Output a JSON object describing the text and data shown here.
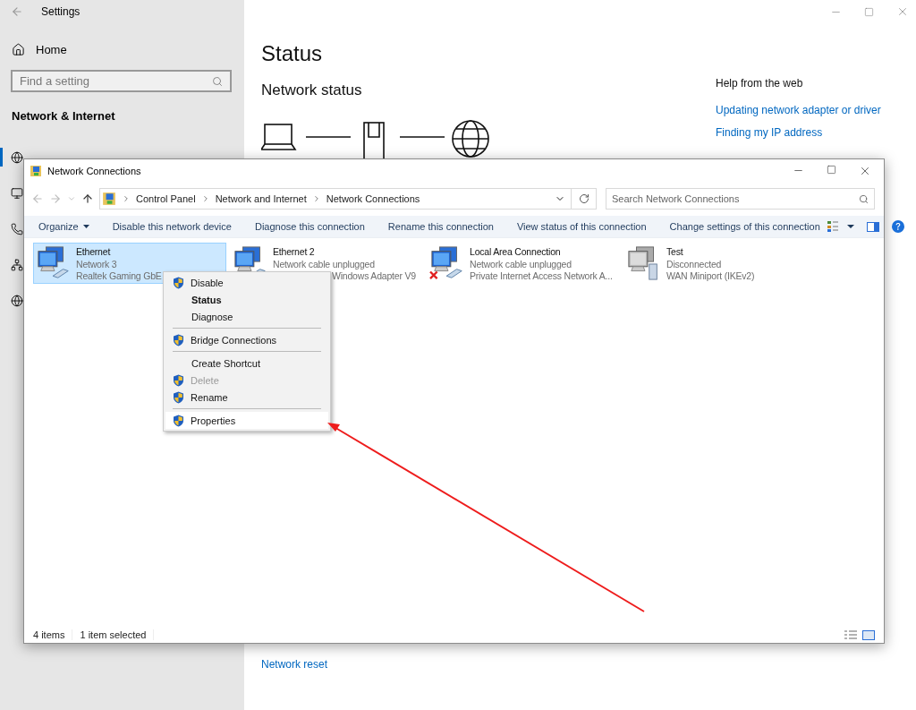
{
  "settings": {
    "title": "Settings",
    "home": "Home",
    "search": {
      "placeholder": "Find a setting"
    },
    "section": "Network & Internet",
    "nav_items": [
      {
        "kind": "status",
        "selected": true
      },
      {
        "kind": "ethernet",
        "selected": false
      },
      {
        "kind": "dialup",
        "selected": false
      },
      {
        "kind": "vpn",
        "selected": false
      },
      {
        "kind": "proxy",
        "selected": false
      }
    ],
    "heading": "Status",
    "subheading": "Network status",
    "help": {
      "title": "Help from the web",
      "links": [
        "Updating network adapter or driver",
        "Finding my IP address"
      ]
    },
    "reset_link": "Network reset"
  },
  "connections_window": {
    "title": "Network Connections",
    "breadcrumb": [
      "Control Panel",
      "Network and Internet",
      "Network Connections"
    ],
    "search": {
      "placeholder": "Search Network Connections"
    },
    "commands": [
      {
        "label": "Organize",
        "kind": "menu"
      },
      {
        "label": "Disable this network device",
        "kind": "action"
      },
      {
        "label": "Diagnose this connection",
        "kind": "action"
      },
      {
        "label": "Rename this connection",
        "kind": "action"
      },
      {
        "label": "View status of this connection",
        "kind": "action"
      },
      {
        "label": "Change settings of this connection",
        "kind": "action"
      }
    ],
    "items": [
      {
        "name": "Ethernet",
        "lines": [
          "Network 3",
          "Realtek Gaming GbE"
        ],
        "kind": "wired",
        "error": false,
        "covered": false,
        "selected": true
      },
      {
        "name": "Ethernet 2",
        "lines": [
          "Network cable unplugged",
          "Windows Adapter V9"
        ],
        "kind": "wired",
        "error": false,
        "covered": true,
        "selected": false
      },
      {
        "name": "Local Area Connection",
        "lines": [
          "Network cable unplugged",
          "Private Internet Access Network A..."
        ],
        "kind": "wired",
        "error": true,
        "covered": false,
        "selected": false
      },
      {
        "name": "Test",
        "lines": [
          "Disconnected",
          "WAN Miniport (IKEv2)"
        ],
        "kind": "wan",
        "error": false,
        "covered": false,
        "selected": false
      }
    ],
    "status_bar": [
      "4 items",
      "1 item selected"
    ]
  },
  "context_menu": [
    {
      "kind": "item",
      "label": "Disable",
      "shield": true,
      "default": false,
      "disabled": false,
      "selected": false
    },
    {
      "kind": "item",
      "label": "Status",
      "shield": false,
      "default": true,
      "disabled": false,
      "selected": false
    },
    {
      "kind": "item",
      "label": "Diagnose",
      "shield": false,
      "default": false,
      "disabled": false,
      "selected": false
    },
    {
      "kind": "separator"
    },
    {
      "kind": "item",
      "label": "Bridge Connections",
      "shield": true,
      "default": false,
      "disabled": false,
      "selected": false
    },
    {
      "kind": "separator"
    },
    {
      "kind": "item",
      "label": "Create Shortcut",
      "shield": false,
      "default": false,
      "disabled": false,
      "selected": false
    },
    {
      "kind": "item",
      "label": "Delete",
      "shield": true,
      "default": false,
      "disabled": true,
      "selected": false
    },
    {
      "kind": "item",
      "label": "Rename",
      "shield": true,
      "default": false,
      "disabled": false,
      "selected": false
    },
    {
      "kind": "separator"
    },
    {
      "kind": "item",
      "label": "Properties",
      "shield": true,
      "default": false,
      "disabled": false,
      "selected": true
    }
  ]
}
